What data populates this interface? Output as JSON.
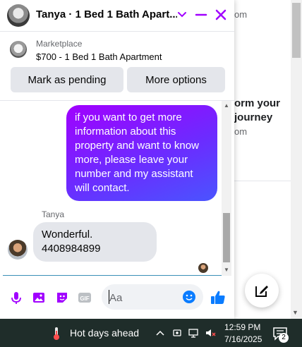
{
  "background": {
    "fragment_1": "om",
    "fragment_2": "orm your",
    "fragment_3": "journey",
    "fragment_4": "om"
  },
  "chat": {
    "title": "Tanya · 1 Bed 1 Bath Apart...",
    "listing": {
      "source": "Marketplace",
      "title": "$700 - 1 Bed 1 Bath Apartment"
    },
    "actions": {
      "mark_pending": "Mark as pending",
      "more_options": "More options"
    },
    "messages": [
      {
        "direction": "outgoing",
        "text": "if you want to get more information about this property and want to know more, please leave your number and my assistant will contact."
      },
      {
        "direction": "incoming",
        "sender": "Tanya",
        "line1": "Wonderful.",
        "line2": "4408984899"
      }
    ],
    "composer": {
      "placeholder": "Aa",
      "icons": [
        "microphone-icon",
        "photo-icon",
        "sticker-icon",
        "gif-icon",
        "emoji-icon",
        "thumbs-up-icon"
      ]
    },
    "accent_color": "#a100ff"
  },
  "taskbar": {
    "weather": "Hot days ahead",
    "time": "12:59 PM",
    "date": "7/16/2025",
    "notification_count": "2"
  }
}
